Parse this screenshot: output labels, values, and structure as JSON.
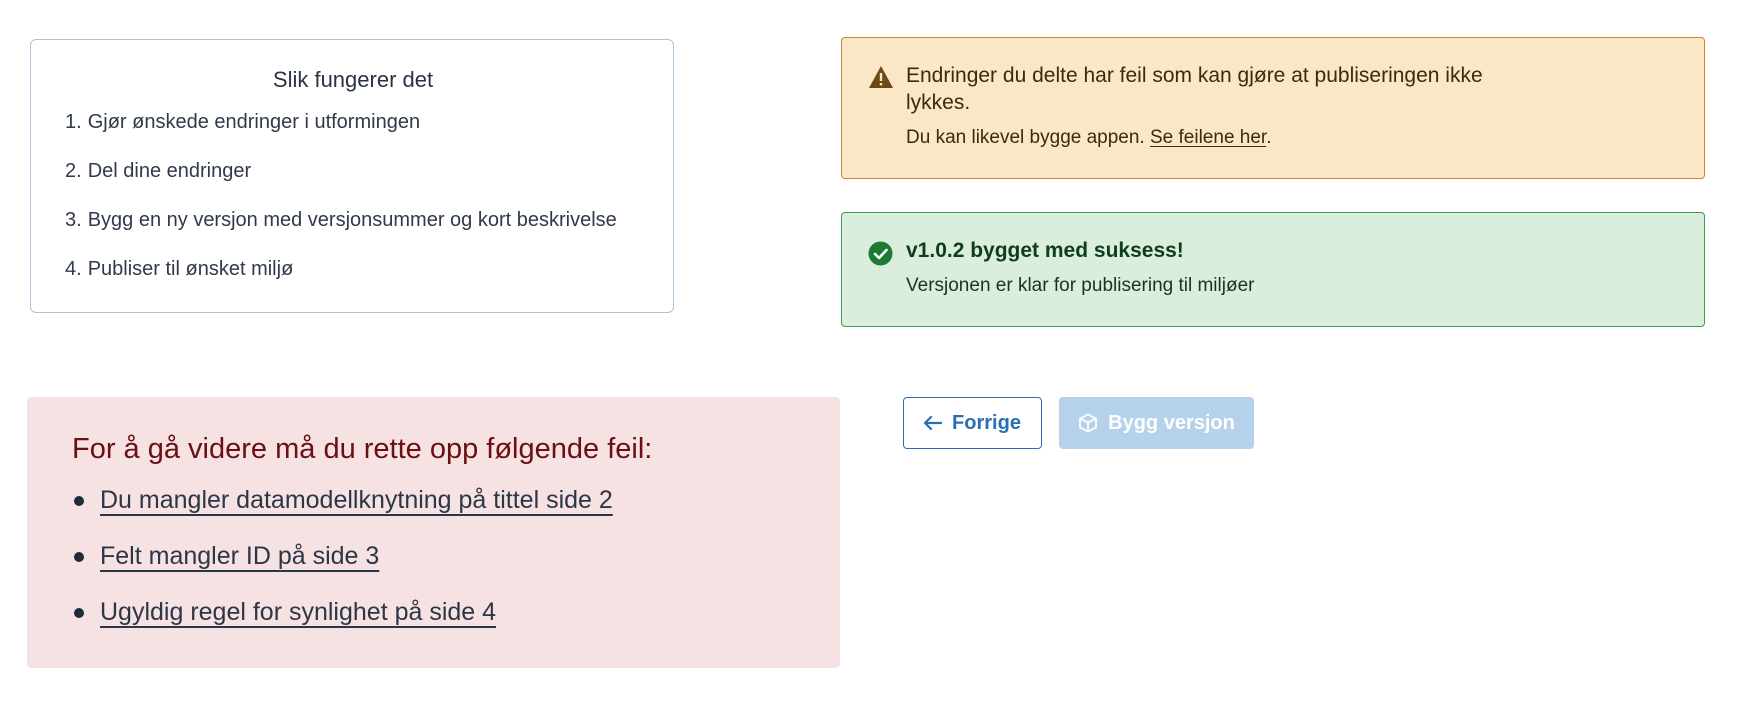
{
  "howto": {
    "title": "Slik fungerer det",
    "steps": [
      {
        "num": "1.",
        "text": "Gjør ønskede endringer i utformingen"
      },
      {
        "num": "2.",
        "text": "Del dine endringer"
      },
      {
        "num": "3.",
        "text": "Bygg en ny versjon med versjonsummer og kort beskrivelse"
      },
      {
        "num": "4.",
        "text": "Publiser til ønsket miljø"
      }
    ]
  },
  "warning": {
    "icon": "warning-triangle-icon",
    "heading": "Endringer du delte har feil som kan gjøre at publiseringen ikke lykkes.",
    "body_prefix": "Du kan likevel bygge appen. ",
    "link_label": "Se feilene her",
    "body_suffix": ".",
    "color": "#fbe6c6"
  },
  "success": {
    "icon": "check-circle-icon",
    "heading": "v1.0.2 bygget med suksess!",
    "body": "Versjonen er klar for publisering til miljøer",
    "color": "#daeedd"
  },
  "errors": {
    "title": "For å gå videre må du rette opp følgende feil:",
    "items": [
      "Du mangler datamodellknytning på tittel side 2",
      "Felt mangler ID på side 3",
      "Ugyldig regel for synlighet på side 4"
    ],
    "color": "#f6e2e3"
  },
  "actions": {
    "prev_label": "Forrige",
    "prev_icon": "arrow-left-icon",
    "build_label": "Bygg versjon",
    "build_icon": "package-icon",
    "accent": "#2a6fb5"
  }
}
